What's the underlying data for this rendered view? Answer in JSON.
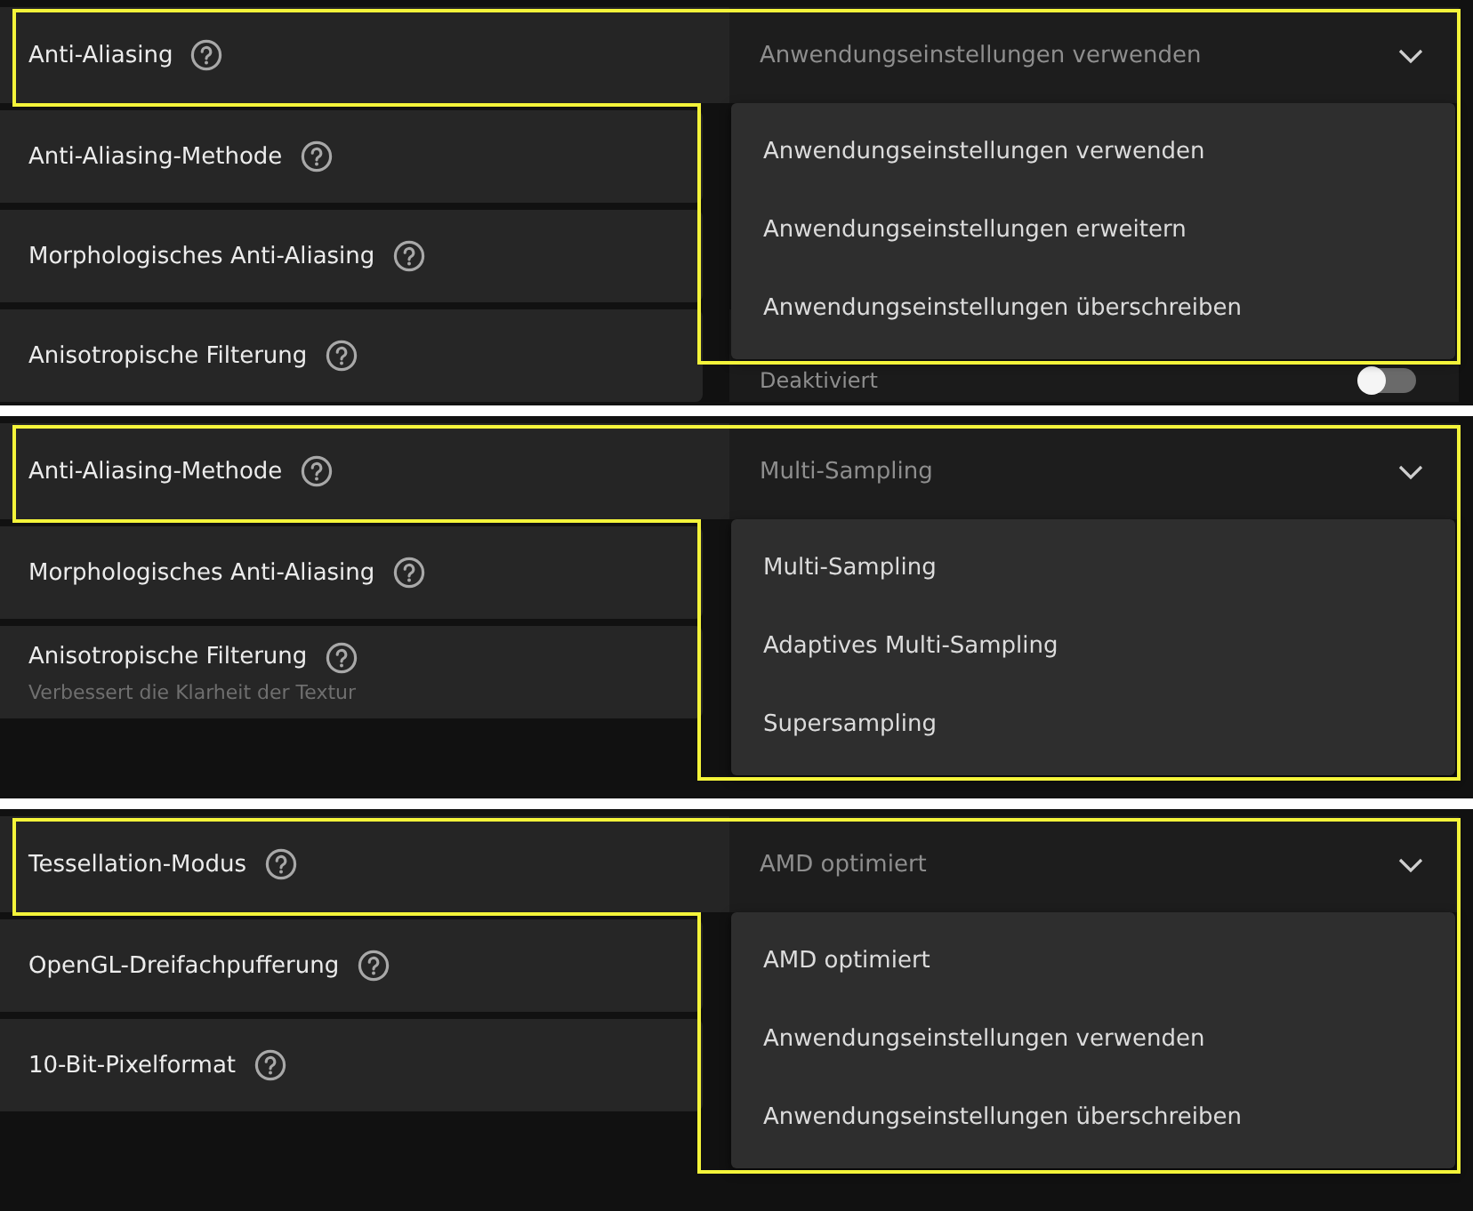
{
  "panels": [
    {
      "setting": {
        "label": "Anti-Aliasing",
        "dropdown": {
          "value": "Anwendungseinstellungen verwenden",
          "expanded": true,
          "options": [
            {
              "label": "Anwendungseinstellungen verwenden"
            },
            {
              "label": "Anwendungseinstellungen erweitern"
            },
            {
              "label": "Anwendungseinstellungen überschreiben"
            }
          ]
        }
      },
      "rows": [
        {
          "label": "Anti-Aliasing-Methode"
        },
        {
          "label": "Morphologisches Anti-Aliasing"
        },
        {
          "label": "Anisotropische Filterung",
          "control": {
            "kind": "toggle",
            "text": "Deaktiviert",
            "on": false
          }
        }
      ]
    },
    {
      "setting": {
        "label": "Anti-Aliasing-Methode",
        "dropdown": {
          "value": "Multi-Sampling",
          "expanded": true,
          "options": [
            {
              "label": "Multi-Sampling"
            },
            {
              "label": "Adaptives Multi-Sampling"
            },
            {
              "label": "Supersampling"
            }
          ]
        }
      },
      "rows": [
        {
          "label": "Morphologisches Anti-Aliasing"
        },
        {
          "label": "Anisotropische Filterung",
          "description": "Verbessert die Klarheit der Textur"
        }
      ]
    },
    {
      "setting": {
        "label": "Tessellation-Modus",
        "dropdown": {
          "value": "AMD optimiert",
          "expanded": true,
          "options": [
            {
              "label": "AMD optimiert"
            },
            {
              "label": "Anwendungseinstellungen verwenden"
            },
            {
              "label": "Anwendungseinstellungen überschreiben"
            }
          ]
        }
      },
      "rows": [
        {
          "label": "OpenGL-Dreifachpufferung"
        },
        {
          "label": "10-Bit-Pixelformat"
        }
      ]
    }
  ]
}
